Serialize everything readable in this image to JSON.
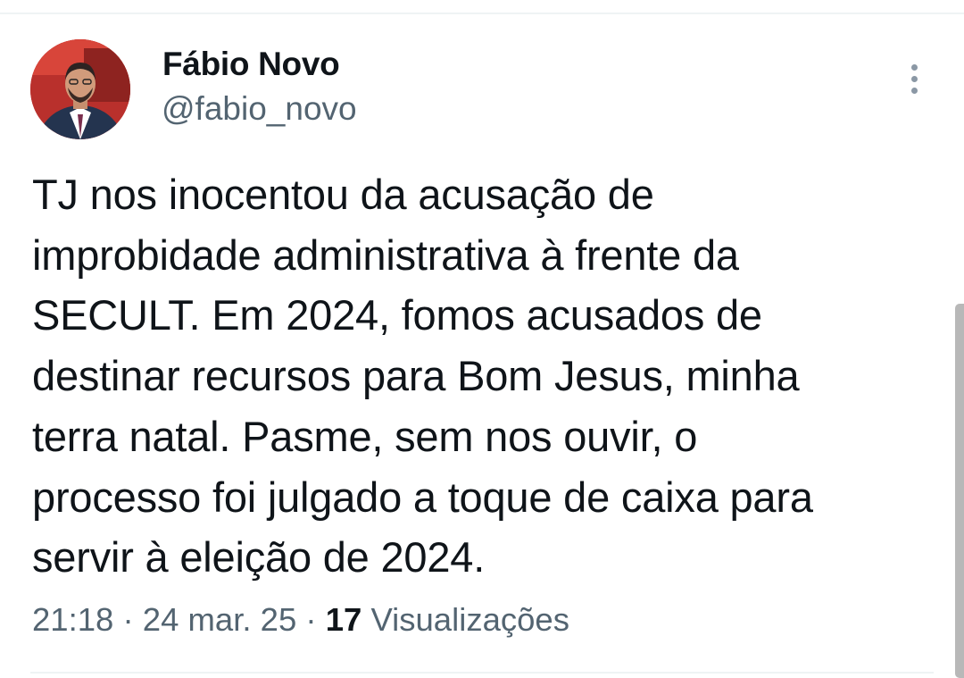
{
  "author": {
    "name": "Fábio Novo",
    "handle": "@fabio_novo",
    "avatar_icon": "profile-photo"
  },
  "tweet": {
    "text": "TJ nos inocentou da acusação de\nimprobidade administrativa à frente da\nSECULT. Em 2024, fomos acusados de\ndestinar recursos para Bom Jesus, minha\nterra natal. Pasme, sem nos ouvir, o\nprocesso foi julgado a toque de caixa para\nservir à eleição de 2024."
  },
  "meta": {
    "time": "21:18",
    "date": "24 mar. 25",
    "separator": " · ",
    "views_count": "17",
    "views_label": "Visualizações"
  },
  "menu": {
    "icon": "more-vertical-icon"
  },
  "colors": {
    "text_primary": "#0f1419",
    "text_secondary": "#536471",
    "divider": "#eff3f4",
    "menu_dots": "#8b98a5"
  }
}
